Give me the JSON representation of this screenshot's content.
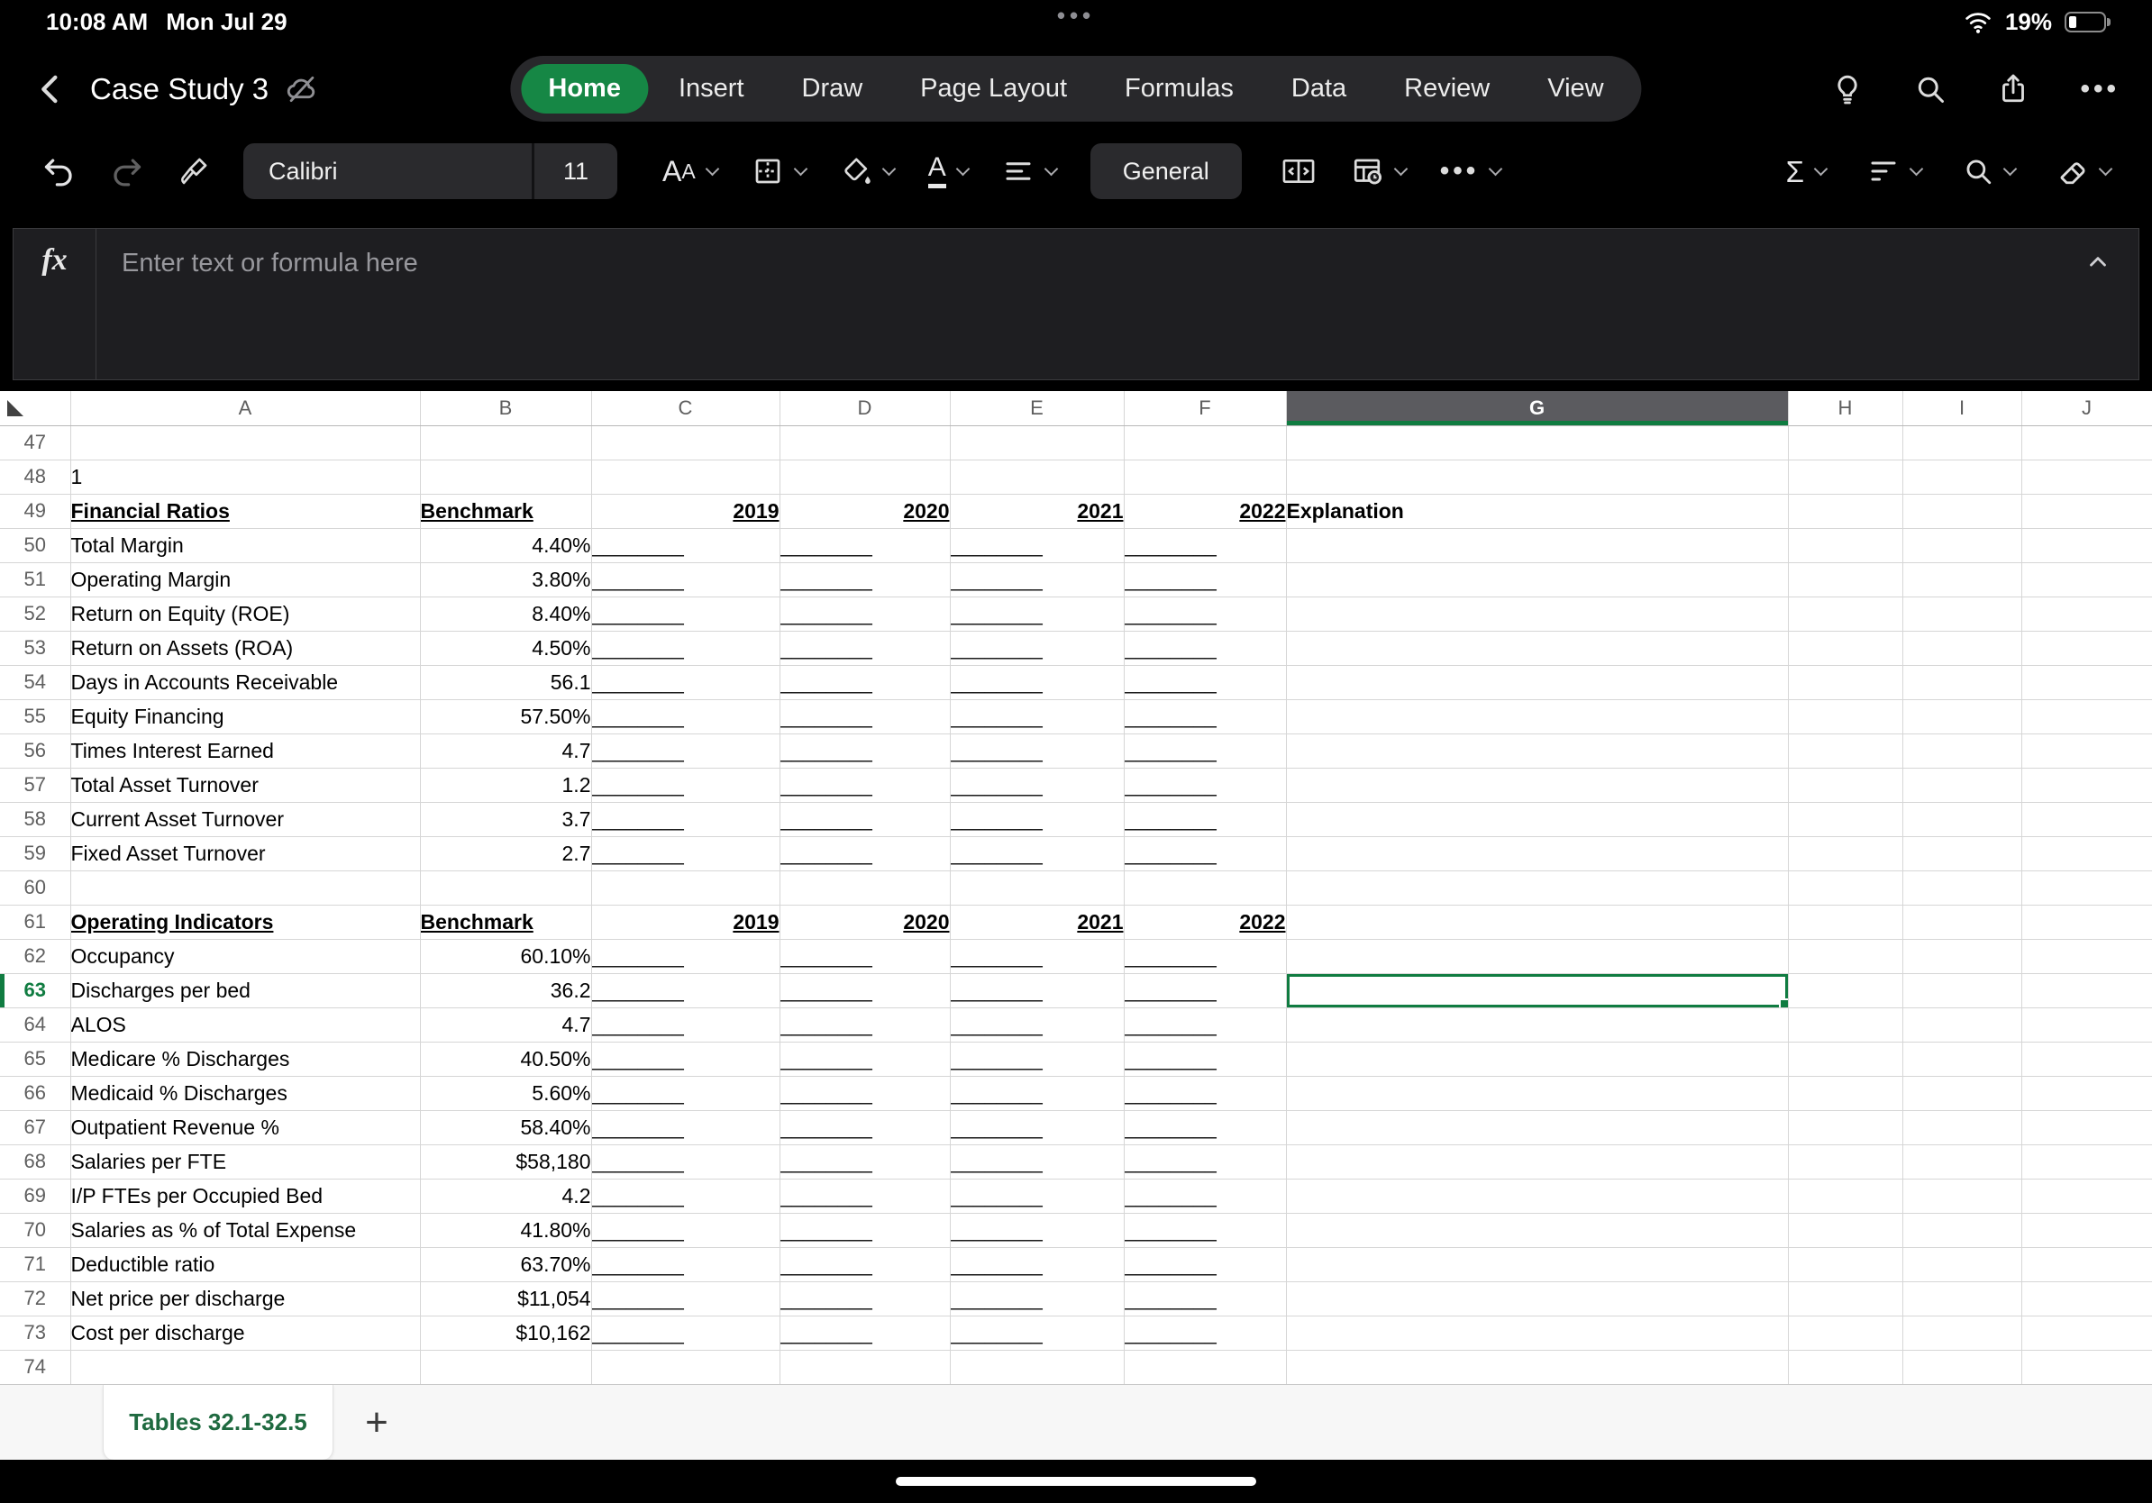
{
  "status_bar": {
    "time": "10:08 AM",
    "date": "Mon Jul 29",
    "dots": "•••",
    "battery_percent": "19%"
  },
  "ribbon": {
    "doc_title": "Case Study 3",
    "tabs": [
      {
        "label": "Home",
        "active": true
      },
      {
        "label": "Insert",
        "active": false
      },
      {
        "label": "Draw",
        "active": false
      },
      {
        "label": "Page Layout",
        "active": false
      },
      {
        "label": "Formulas",
        "active": false
      },
      {
        "label": "Data",
        "active": false
      },
      {
        "label": "Review",
        "active": false
      },
      {
        "label": "View",
        "active": false
      }
    ]
  },
  "toolbar": {
    "font_name": "Calibri",
    "font_size": "11",
    "font_button_label": "AA",
    "font_color_glyph": "A",
    "number_format": "General",
    "sum_glyph": "Σ",
    "more_dots": "•••"
  },
  "formula_bar": {
    "fx_label": "fx",
    "placeholder": "Enter text or formula here"
  },
  "grid": {
    "columns": [
      "A",
      "B",
      "C",
      "D",
      "E",
      "F",
      "G",
      "H",
      "I",
      "J"
    ],
    "selected_column": "G",
    "selected_row": 63,
    "blank_text": "________",
    "rows": [
      {
        "n": 47,
        "type": "blank"
      },
      {
        "n": 48,
        "type": "plain",
        "a": "1"
      },
      {
        "n": 49,
        "type": "header",
        "a": "Financial Ratios",
        "b": "Benchmark",
        "years": [
          "2019",
          "2020",
          "2021",
          "2022"
        ],
        "g": "Explanation"
      },
      {
        "n": 50,
        "type": "data",
        "a": "Total Margin",
        "b": "4.40%"
      },
      {
        "n": 51,
        "type": "data",
        "a": "Operating Margin",
        "b": "3.80%"
      },
      {
        "n": 52,
        "type": "data",
        "a": "Return on Equity (ROE)",
        "b": "8.40%"
      },
      {
        "n": 53,
        "type": "data",
        "a": "Return on Assets (ROA)",
        "b": "4.50%"
      },
      {
        "n": 54,
        "type": "data",
        "a": "Days in Accounts Receivable",
        "b": "56.1"
      },
      {
        "n": 55,
        "type": "data",
        "a": "Equity Financing",
        "b": "57.50%"
      },
      {
        "n": 56,
        "type": "data",
        "a": "Times Interest Earned",
        "b": "4.7"
      },
      {
        "n": 57,
        "type": "data",
        "a": "Total Asset Turnover",
        "b": "1.2"
      },
      {
        "n": 58,
        "type": "data",
        "a": "Current Asset Turnover",
        "b": "3.7"
      },
      {
        "n": 59,
        "type": "data",
        "a": "Fixed Asset Turnover",
        "b": "2.7"
      },
      {
        "n": 60,
        "type": "blank"
      },
      {
        "n": 61,
        "type": "header",
        "a": "Operating Indicators",
        "b": "Benchmark",
        "years": [
          "2019",
          "2020",
          "2021",
          "2022"
        ],
        "g": ""
      },
      {
        "n": 62,
        "type": "data",
        "a": "Occupancy",
        "b": "60.10%"
      },
      {
        "n": 63,
        "type": "data",
        "a": "Discharges per bed",
        "b": "36.2"
      },
      {
        "n": 64,
        "type": "data",
        "a": "ALOS",
        "b": "4.7"
      },
      {
        "n": 65,
        "type": "data",
        "a": "Medicare % Discharges",
        "b": "40.50%"
      },
      {
        "n": 66,
        "type": "data",
        "a": "Medicaid % Discharges",
        "b": "5.60%"
      },
      {
        "n": 67,
        "type": "data",
        "a": "Outpatient Revenue %",
        "b": "58.40%"
      },
      {
        "n": 68,
        "type": "data",
        "a": "Salaries per FTE",
        "b": "$58,180"
      },
      {
        "n": 69,
        "type": "data",
        "a": "I/P FTEs per Occupied Bed",
        "b": "4.2"
      },
      {
        "n": 70,
        "type": "data",
        "a": "Salaries as % of Total Expense",
        "b": "41.80%"
      },
      {
        "n": 71,
        "type": "data",
        "a": "Deductible ratio",
        "b": "63.70%"
      },
      {
        "n": 72,
        "type": "data",
        "a": "Net price per discharge",
        "b": "$11,054"
      },
      {
        "n": 73,
        "type": "data",
        "a": "Cost per discharge",
        "b": "$10,162"
      },
      {
        "n": 74,
        "type": "blank"
      }
    ]
  },
  "sheet_bar": {
    "active_tab": "Tables 32.1-32.5",
    "add_label": "+"
  },
  "colors": {
    "accent_green": "#107C41",
    "pill_green": "#168745"
  }
}
